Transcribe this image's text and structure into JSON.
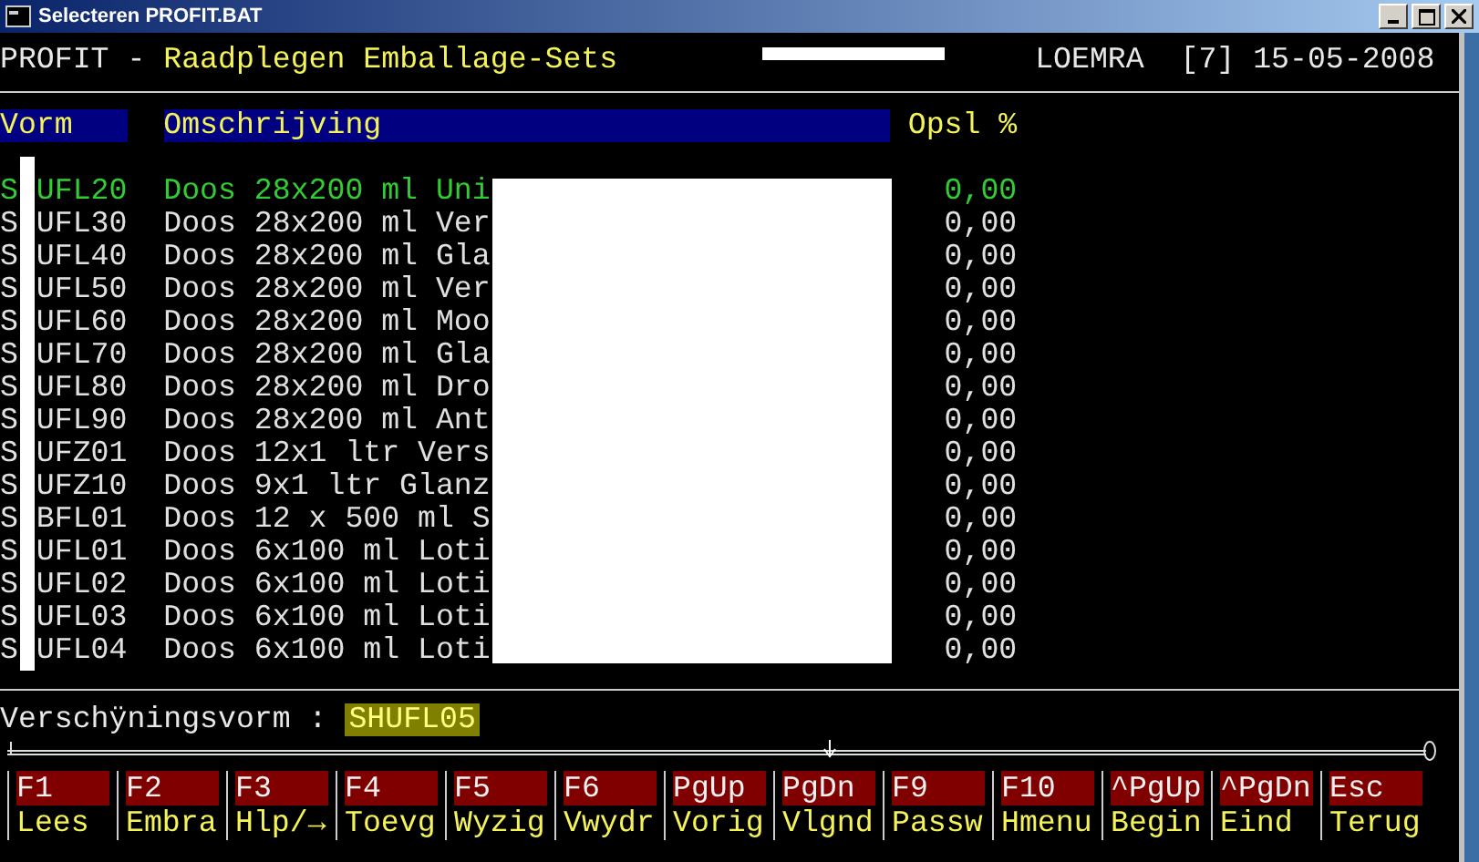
{
  "window": {
    "title": "Selecteren PROFIT.BAT"
  },
  "header": {
    "app": "PROFIT",
    "separator": "-",
    "screen": "Raadplegen Emballage-Sets",
    "user": "LOEMRA",
    "session": "[7]",
    "date": "15-05-2008"
  },
  "table": {
    "columns": [
      "Vorm",
      "Omschrijving",
      "Opsl %"
    ],
    "rows": [
      {
        "code_start": "S",
        "code_end": "UFL20",
        "description": "Doos 28x200 ml Uni",
        "surcharge": "0,00",
        "selected": true
      },
      {
        "code_start": "S",
        "code_end": "UFL30",
        "description": "Doos 28x200 ml Ver",
        "surcharge": "0,00",
        "selected": false
      },
      {
        "code_start": "S",
        "code_end": "UFL40",
        "description": "Doos 28x200 ml Gla",
        "surcharge": "0,00",
        "selected": false
      },
      {
        "code_start": "S",
        "code_end": "UFL50",
        "description": "Doos 28x200 ml Ver",
        "surcharge": "0,00",
        "selected": false
      },
      {
        "code_start": "S",
        "code_end": "UFL60",
        "description": "Doos 28x200 ml Moo",
        "surcharge": "0,00",
        "selected": false
      },
      {
        "code_start": "S",
        "code_end": "UFL70",
        "description": "Doos 28x200 ml Gla",
        "surcharge": "0,00",
        "selected": false
      },
      {
        "code_start": "S",
        "code_end": "UFL80",
        "description": "Doos 28x200 ml Dro",
        "surcharge": "0,00",
        "selected": false
      },
      {
        "code_start": "S",
        "code_end": "UFL90",
        "description": "Doos 28x200 ml Ant",
        "surcharge": "0,00",
        "selected": false
      },
      {
        "code_start": "S",
        "code_end": "UFZ01",
        "description": "Doos 12x1 ltr Vers",
        "surcharge": "0,00",
        "selected": false
      },
      {
        "code_start": "S",
        "code_end": "UFZ10",
        "description": "Doos 9x1 ltr Glanz",
        "surcharge": "0,00",
        "selected": false
      },
      {
        "code_start": "S",
        "code_end": "BFL01",
        "description": "Doos 12 x 500 ml S",
        "surcharge": "0,00",
        "selected": false
      },
      {
        "code_start": "S",
        "code_end": "UFL01",
        "description": "Doos 6x100 ml Loti",
        "surcharge": "0,00",
        "selected": false
      },
      {
        "code_start": "S",
        "code_end": "UFL02",
        "description": "Doos 6x100 ml Loti",
        "surcharge": "0,00",
        "selected": false
      },
      {
        "code_start": "S",
        "code_end": "UFL03",
        "description": "Doos 6x100 ml Loti",
        "surcharge": "0,00",
        "selected": false
      },
      {
        "code_start": "S",
        "code_end": "UFL04",
        "description": "Doos 6x100 ml Loti",
        "surcharge": "0,00",
        "selected": false
      }
    ]
  },
  "input": {
    "label": "Verschÿningsvorm :",
    "value": "SHUFL05"
  },
  "function_keys": [
    {
      "key": "F1",
      "action": "Lees"
    },
    {
      "key": "F2",
      "action": "Embra"
    },
    {
      "key": "F3",
      "action": "Hlp/→"
    },
    {
      "key": "F4",
      "action": "Toevg"
    },
    {
      "key": "F5",
      "action": "Wyzig"
    },
    {
      "key": "F6",
      "action": "Vwydr"
    },
    {
      "key": "PgUp",
      "action": "Vorig"
    },
    {
      "key": "PgDn",
      "action": "Vlgnd"
    },
    {
      "key": "F9",
      "action": "Passw"
    },
    {
      "key": "F10",
      "action": "Hmenu"
    },
    {
      "key": "^PgUp",
      "action": "Begin"
    },
    {
      "key": "^PgDn",
      "action": "Eind"
    },
    {
      "key": "Esc",
      "action": "Terug"
    }
  ]
}
